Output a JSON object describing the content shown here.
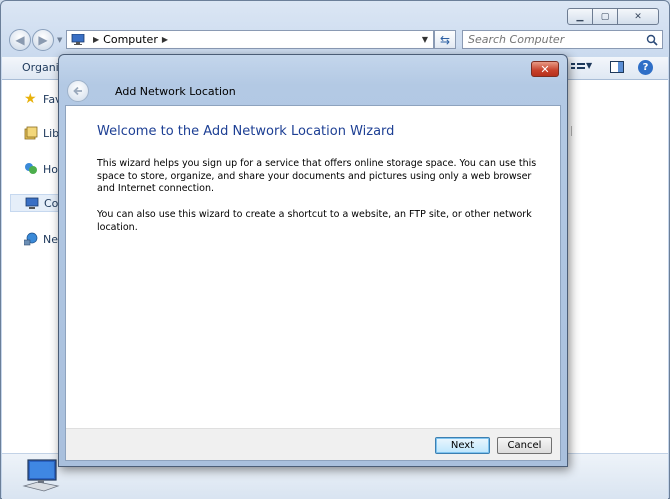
{
  "explorer": {
    "address": {
      "location": "Computer"
    },
    "search": {
      "placeholder": "Search Computer"
    },
    "toolbar": {
      "organize_label": "Organiz"
    },
    "nav": {
      "favorites": "Favi",
      "libraries": "Libr",
      "homegroup": "Hor",
      "computer": "Con",
      "network": "Net"
    }
  },
  "wizard": {
    "title": "Add Network Location",
    "heading": "Welcome to the Add Network Location Wizard",
    "paragraph1": "This wizard helps you sign up for a service that offers online storage space.  You can use this space to store, organize, and share your documents and pictures using only a web browser and Internet connection.",
    "paragraph2": "You can also use this wizard to create a shortcut to a website, an FTP site, or other network location.",
    "next_label": "Next",
    "cancel_label": "Cancel"
  },
  "colors": {
    "heading": "#1d3f94",
    "close_button": "#c7402a",
    "frame": "#b3c9e4"
  },
  "icons": [
    "back-arrow-icon",
    "forward-arrow-icon",
    "computer-icon",
    "refresh-icon",
    "search-icon",
    "star-icon",
    "library-icon",
    "homegroup-icon",
    "network-icon",
    "help-icon",
    "close-icon",
    "minimize-icon",
    "maximize-icon"
  ]
}
